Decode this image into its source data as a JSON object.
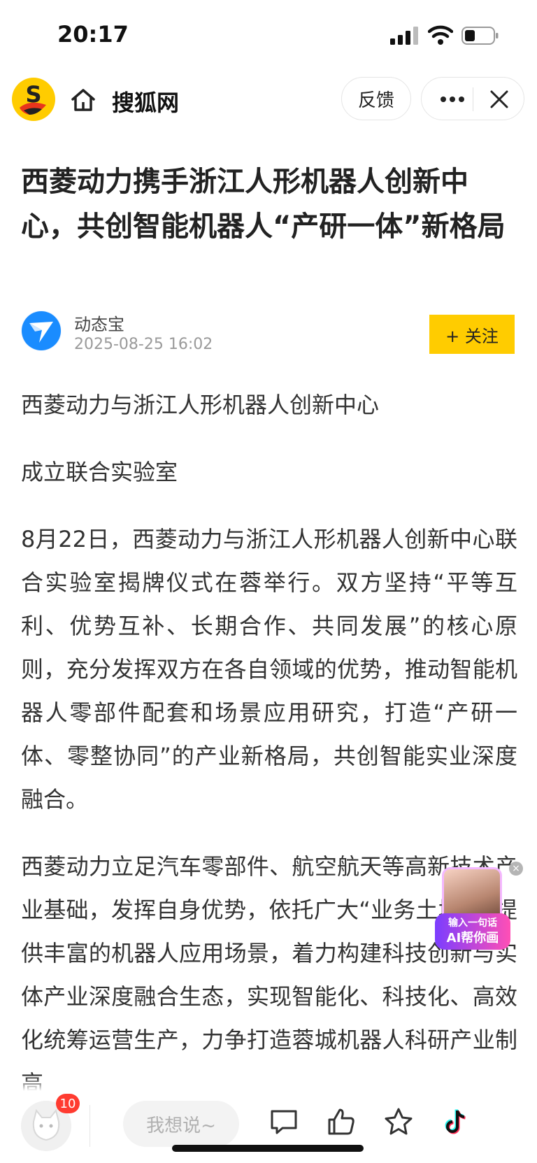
{
  "status_bar": {
    "time": "20:17"
  },
  "header": {
    "site_name": "搜狐网",
    "feedback_label": "反馈"
  },
  "article": {
    "title": "西菱动力携手浙江人形机器人创新中心，共创智能机器人“产研一体”新格局",
    "author": "动态宝",
    "published": "2025-08-25 16:02",
    "follow_label": "+ 关注",
    "paragraphs": [
      "西菱动力与浙江人形机器人创新中心",
      "成立联合实验室",
      "8月22日，西菱动力与浙江人形机器人创新中心联合实验室揭牌仪式在蓉举行。双方坚持“平等互利、优势互补、长期合作、共同发展”的核心原则，充分发挥双方在各自领域的优势，推动智能机器人零部件配套和场景应用研究，打造“产研一体、零整协同”的产业新格局，共创智能实业深度融合。",
      "西菱动力立足汽车零部件、航空航天等高新技术产业基础，发挥自身优势，依托广大“业务土壤”，提供丰富的机器人应用场景，着力构建科技创新与实体产业深度融合生态，实现智能化、科技化、高效化统筹运营生产，力争打造蓉城机器人科研产业制高"
    ]
  },
  "ai_widget": {
    "line1": "输入一句话",
    "line2": "AI帮你画"
  },
  "bottom_bar": {
    "comment_placeholder": "我想说~",
    "notification_count": "10"
  },
  "icons": [
    "sohu-logo-icon",
    "home-icon",
    "more-icon",
    "close-icon",
    "author-avatar-icon",
    "comment-icon",
    "like-icon",
    "star-icon",
    "tiktok-icon"
  ],
  "colors": {
    "accent": "#ffcc00",
    "badge": "#ff3b30"
  }
}
